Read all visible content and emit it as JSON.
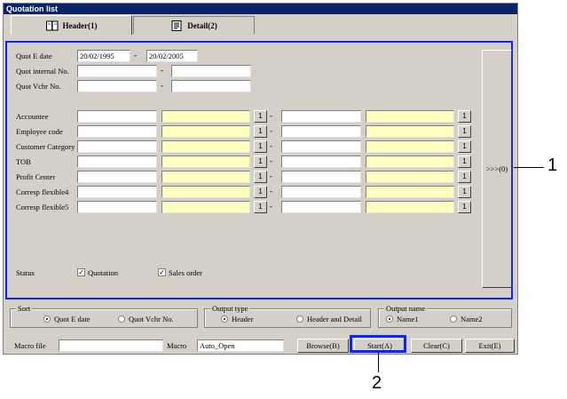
{
  "window": {
    "title": "Quotation list"
  },
  "tabs": [
    {
      "label": "Header(1)",
      "icon": "book-icon"
    },
    {
      "label": "Detail(2)",
      "icon": "document-icon"
    }
  ],
  "criteria": {
    "quot_e_date": {
      "label": "Quot E date",
      "from": "20/02/1995",
      "to": "20/02/2005"
    },
    "quot_internal_no": {
      "label": "Quot internal No.",
      "from": "",
      "to": ""
    },
    "quot_vchr_no": {
      "label": "Quot Vchr No.",
      "from": "",
      "to": ""
    },
    "rows": [
      {
        "label": "Accountee"
      },
      {
        "label": "Employee code"
      },
      {
        "label": "Customer Category"
      },
      {
        "label": "TOB"
      },
      {
        "label": "Profit Center"
      },
      {
        "label": "Corresp flexible4"
      },
      {
        "label": "Corresp flexible5"
      }
    ],
    "search_button_label": "1",
    "dash": "-",
    "expand_button_label": ">>>(0)"
  },
  "status": {
    "label": "Status",
    "quotation": {
      "label": "Quotation",
      "checked": true
    },
    "sales_order": {
      "label": "Sales order",
      "checked": true
    },
    "check_mark": "✓"
  },
  "sort": {
    "label": "Sort",
    "options": [
      {
        "label": "Quot E date",
        "selected": true
      },
      {
        "label": "Quot Vchr No.",
        "selected": false
      }
    ]
  },
  "output_type": {
    "label": "Output type",
    "options": [
      {
        "label": "Header",
        "selected": true
      },
      {
        "label": "Header and Detail",
        "selected": false
      }
    ]
  },
  "output_name": {
    "label": "Output name",
    "options": [
      {
        "label": "Name1",
        "selected": true
      },
      {
        "label": "Name2",
        "selected": false
      }
    ]
  },
  "macro": {
    "file_label": "Macro file",
    "file_value": "",
    "macro_label": "Macro",
    "macro_value": "Auto_Open"
  },
  "buttons": {
    "browse": "Browse(B)",
    "start": "Start(A)",
    "clear": "Clear(C)",
    "exit": "Exit(E)"
  },
  "callouts": {
    "one": "1",
    "two": "2"
  },
  "colors": {
    "highlight": "#0a24ff",
    "titlebar": "#0a246a",
    "yellow_field": "#ffffc0"
  }
}
